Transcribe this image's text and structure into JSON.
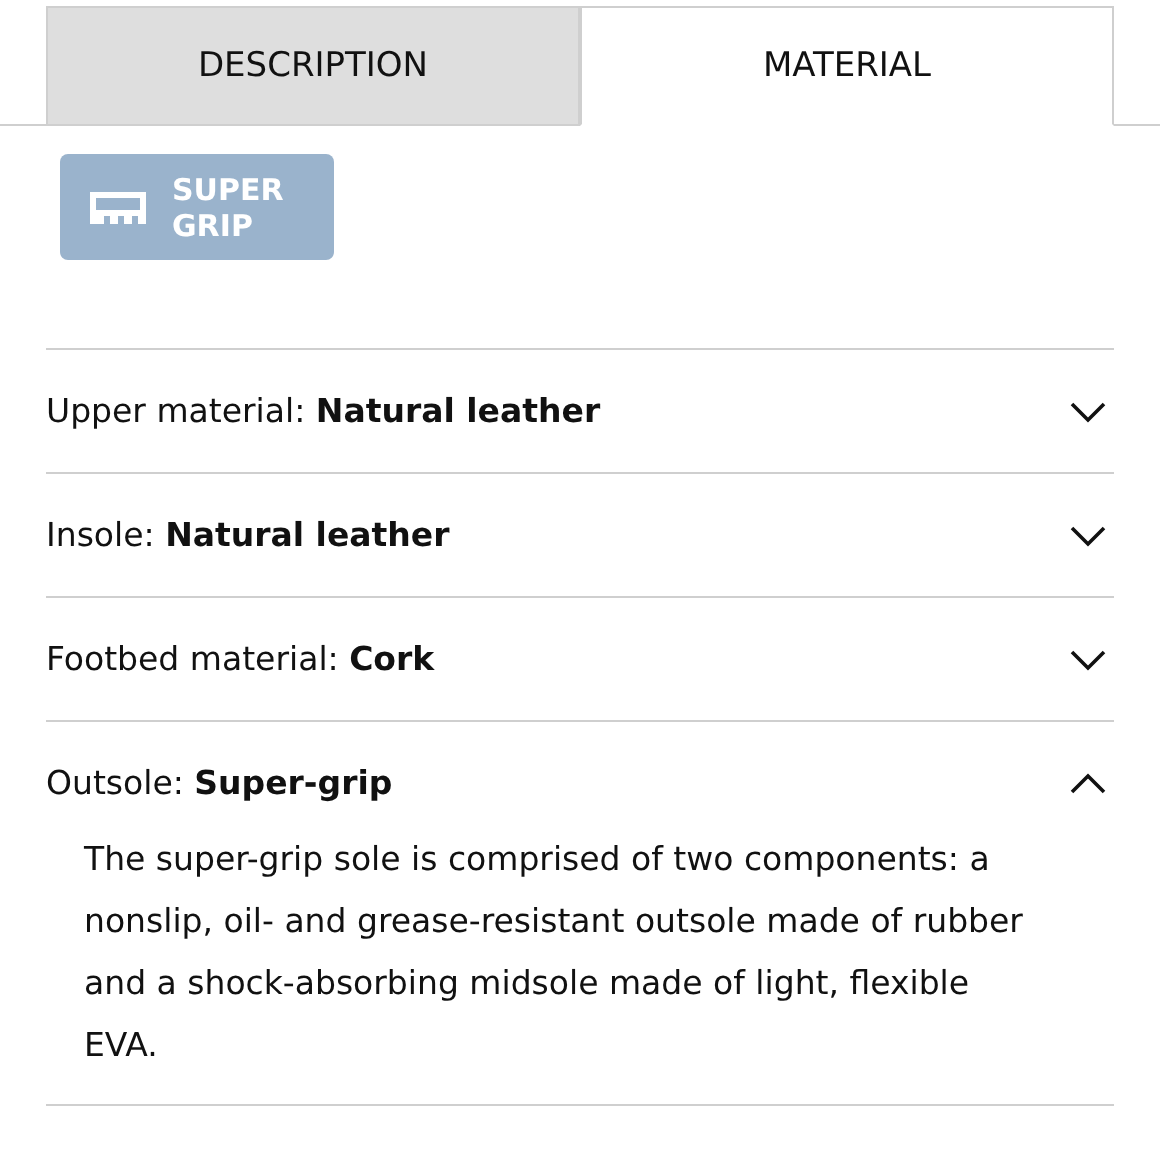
{
  "tabs": [
    {
      "label": "DESCRIPTION",
      "selected": false
    },
    {
      "label": "MATERIAL",
      "selected": true
    }
  ],
  "badge": {
    "label": "SUPER GRIP"
  },
  "materials": [
    {
      "label": "Upper material: **Natural leather**",
      "expanded": false
    },
    {
      "label": "Insole: **Natural leather**",
      "expanded": false
    },
    {
      "label": "Footbed material: **Cork**",
      "expanded": false
    },
    {
      "label": "Outsole: **Super-grip**",
      "expanded": true,
      "text": "The super-grip sole is comprised of two components: a nonslip, oil- and grease-resistant outsole made of rubber and a shock-absorbing midsole made of light, flexible EVA."
    }
  ]
}
